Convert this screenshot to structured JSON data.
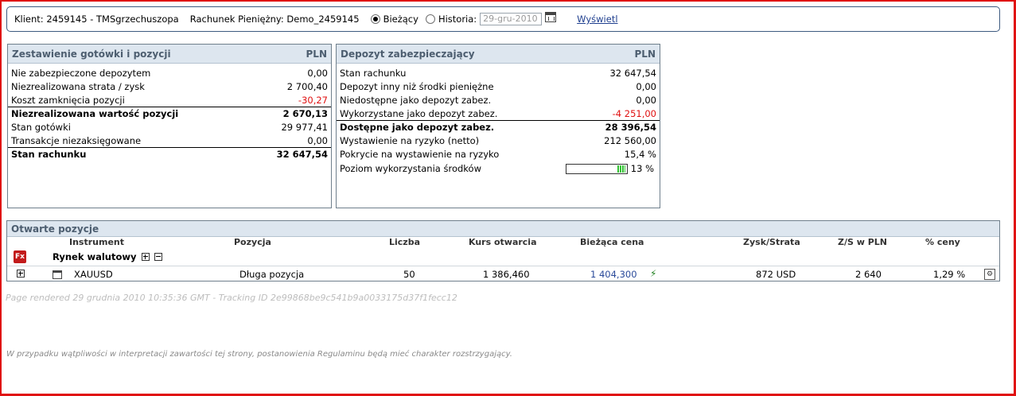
{
  "topbar": {
    "client_text": "Klient: 2459145 - TMSgrzechuszopa",
    "account_text": "Rachunek Pieniężny: Demo_2459145",
    "current_label": "Bieżący",
    "history_label": "Historia:",
    "date_value": "29-gru-2010",
    "show_link": "Wyświetl",
    "selected_mode": "Bieżący"
  },
  "summary": {
    "title": "Zestawienie gotówki i pozycji",
    "currency": "PLN",
    "rows": [
      {
        "label": "Nie zabezpieczone depozytem",
        "value": "0,00"
      },
      {
        "label": "Niezrealizowana strata / zysk",
        "value": "2 700,40"
      },
      {
        "label": "Koszt zamknięcia pozycji",
        "value": "-30,27"
      },
      {
        "label": "Niezrealizowana wartość pozycji",
        "value": "2 670,13"
      },
      {
        "label": "Stan gotówki",
        "value": "29 977,41"
      },
      {
        "label": "Transakcje niezaksięgowane",
        "value": "0,00"
      },
      {
        "label": "Stan rachunku",
        "value": "32 647,54"
      }
    ]
  },
  "margin": {
    "title": "Depozyt zabezpieczający",
    "currency": "PLN",
    "rows": [
      {
        "label": "Stan rachunku",
        "value": "32 647,54"
      },
      {
        "label": "Depozyt inny niż środki pieniężne",
        "value": "0,00"
      },
      {
        "label": "Niedostępne jako depozyt zabez.",
        "value": "0,00"
      },
      {
        "label": "Wykorzystane jako depozyt zabez.",
        "value": "-4 251,00"
      },
      {
        "label": "Dostępne jako depozyt zabez.",
        "value": "28 396,54"
      },
      {
        "label": "Wystawienie na ryzyko (netto)",
        "value": "212 560,00"
      },
      {
        "label": "Pokrycie na wystawienie na ryzyko",
        "value": "15,4 %"
      },
      {
        "label": "Poziom wykorzystania środków",
        "value": "13 %"
      }
    ],
    "utilization_fraction": 0.13
  },
  "positions": {
    "title": "Otwarte pozycje",
    "columns": {
      "instrument": "Instrument",
      "position": "Pozycja",
      "quantity": "Liczba",
      "open_rate": "Kurs otwarcia",
      "current_price": "Bieżąca cena",
      "pnl": "Zysk/Strata",
      "pnl_pln": "Z/S w PLN",
      "pct_price": "% ceny"
    },
    "group": {
      "icon_text": "Fx",
      "label": "Rynek walutowy"
    },
    "rows": [
      {
        "instrument": "XAUUSD",
        "position": "Długa pozycja",
        "quantity": "50",
        "open_rate": "1 386,460",
        "current_price": "1 404,300",
        "pnl": "872 USD",
        "pnl_pln": "2 640",
        "pct_price": "1,29 %"
      }
    ]
  },
  "footer": {
    "rendered": "Page rendered 29 grudnia 2010 10:35:36 GMT - Tracking ID 2e99868be9c541b9a0033175d37f1fecc12",
    "disclaimer": "W przypadku wątpliwości w interpretacji zawartości tej strony, postanowienia Regulaminu będą mieć charakter rozstrzygający."
  },
  "icons": [
    "calendar-icon",
    "fx-icon",
    "expand-icon",
    "collapse-icon",
    "bolt-icon",
    "settings-icon"
  ],
  "colors": {
    "accent_border": "#e01010",
    "negative": "#e01010",
    "panel_header": "#dde6ef",
    "link": "#1f3f8f"
  }
}
